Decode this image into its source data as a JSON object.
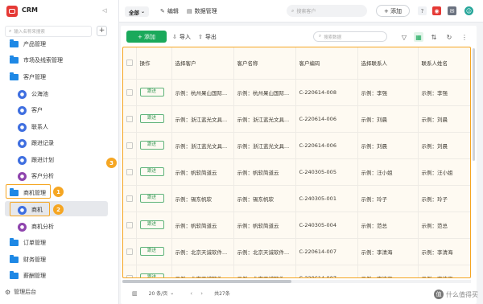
{
  "sidebar": {
    "app_title": "CRM",
    "search_placeholder": "输入名称来搜索",
    "add_label": "+",
    "items": [
      {
        "label": "产品管理",
        "type": "folder"
      },
      {
        "label": "市场及线索管理",
        "type": "folder"
      },
      {
        "label": "客户管理",
        "type": "folder"
      },
      {
        "label": "公海池",
        "type": "sub",
        "color": "#3f6fe0"
      },
      {
        "label": "客户",
        "type": "sub",
        "color": "#3f6fe0"
      },
      {
        "label": "联系人",
        "type": "sub",
        "color": "#3f6fe0"
      },
      {
        "label": "跟进记录",
        "type": "sub",
        "color": "#3f6fe0"
      },
      {
        "label": "跟进计划",
        "type": "sub",
        "color": "#3f6fe0"
      },
      {
        "label": "客户分析",
        "type": "sub",
        "color": "#8e44ad"
      },
      {
        "label": "商机管理",
        "type": "folder"
      },
      {
        "label": "商机",
        "type": "sub",
        "color": "#3f6fe0"
      },
      {
        "label": "商机分析",
        "type": "sub",
        "color": "#8e44ad"
      },
      {
        "label": "订单管理",
        "type": "folder"
      },
      {
        "label": "财务管理",
        "type": "folder"
      },
      {
        "label": "薪酬管理",
        "type": "folder"
      }
    ],
    "settings_label": "管理后台"
  },
  "topbar": {
    "view_label": "全部",
    "edit_label": "编辑",
    "data_mgmt_label": "数据管理",
    "search_placeholder": "搜索客户",
    "add_label": "+ 添加"
  },
  "toolbar": {
    "add_label": "+ 添加",
    "import_label": "导入",
    "export_label": "导出",
    "search_placeholder": "搜索数据"
  },
  "table": {
    "headers": [
      "操作",
      "选择客户",
      "客户名称",
      "客户编码",
      "选择联系人",
      "联系人姓名"
    ],
    "follow_label": "跟进",
    "rows": [
      {
        "select_customer": "示例：杭州果山国际...",
        "customer_name": "示例：杭州果山国际...",
        "code": "C-220614-008",
        "select_contact": "示例：李强",
        "contact_name": "示例：李强"
      },
      {
        "select_customer": "示例：浙江蓝光文具...",
        "customer_name": "示例：浙江蓝光文具...",
        "code": "C-220614-006",
        "select_contact": "示例：刘晨",
        "contact_name": "示例：刘晨"
      },
      {
        "select_customer": "示例：浙江蓝光文具...",
        "customer_name": "示例：浙江蓝光文具...",
        "code": "C-220614-006",
        "select_contact": "示例：刘晨",
        "contact_name": "示例：刘晨"
      },
      {
        "select_customer": "示例：帆软简道云",
        "customer_name": "示例：帆软简道云",
        "code": "C-240305-005",
        "select_contact": "示例：汪小姐",
        "contact_name": "示例：汪小姐"
      },
      {
        "select_customer": "示例：锡东帆软",
        "customer_name": "示例：锡东帆软",
        "code": "C-240305-001",
        "select_contact": "示例：玲子",
        "contact_name": "示例：玲子"
      },
      {
        "select_customer": "示例：帆软简道云",
        "customer_name": "示例：帆软简道云",
        "code": "C-240305-004",
        "select_contact": "示例：范总",
        "contact_name": "示例：范总"
      },
      {
        "select_customer": "示例：北京天诚软件...",
        "customer_name": "示例：北京天诚软件...",
        "code": "C-220614-007",
        "select_contact": "示例：李清海",
        "contact_name": "示例：李清海"
      },
      {
        "select_customer": "示例：北京天诚软件...",
        "customer_name": "示例：北京天诚软件...",
        "code": "C-220614-007",
        "select_contact": "示例：李清海",
        "contact_name": "示例：李清海"
      }
    ]
  },
  "footer": {
    "page_size": "20 条/页",
    "total": "共27条"
  },
  "annotations": {
    "one": "1",
    "two": "2",
    "three": "3"
  },
  "watermark": {
    "icon": "值",
    "text": "什么值得买"
  },
  "colors": {
    "primary_green": "#1aa95b",
    "highlight": "#f5a623",
    "folder_blue": "#1e88e5"
  }
}
